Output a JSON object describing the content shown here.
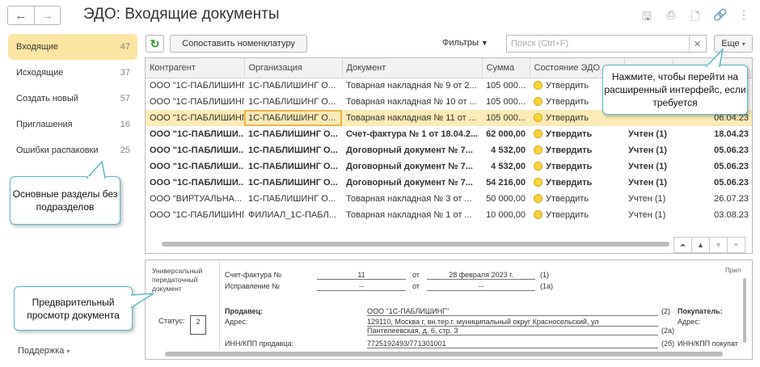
{
  "header": {
    "title": "ЭДО: Входящие документы",
    "back": "←",
    "forward": "→"
  },
  "top_icons": [
    "save-icon",
    "print-icon",
    "preview-icon",
    "link-icon",
    "more-vertical-icon"
  ],
  "sidebar": {
    "items": [
      {
        "label": "Входящие",
        "count": "47",
        "active": true
      },
      {
        "label": "Исходящие",
        "count": "37"
      },
      {
        "label": "Создать новый",
        "count": "57"
      },
      {
        "label": "Приглашения",
        "count": "16"
      },
      {
        "label": "Ошибки распаковки",
        "count": "25"
      }
    ],
    "support": "Поддержка"
  },
  "callouts": {
    "sections": "Основные разделы без подразделов",
    "preview": "Предварительный просмотр документа",
    "advanced": "Нажмите, чтобы перейти на расширенный интерфейс, если требуется"
  },
  "toolbar": {
    "match_label": "Сопоставить номенклатуру",
    "filters_label": "Фильтры",
    "search_placeholder": "Поиск (Ctrl+F)",
    "more_label": "Еще"
  },
  "table": {
    "columns": [
      "Контрагент",
      "Организация",
      "Документ",
      "Сумма",
      "Состояние ЭДО",
      "",
      ""
    ],
    "rows": [
      {
        "c": "ООО \"1С-ПАБЛИШИНГ\"",
        "o": "1С-ПАБЛИШИНГ О...",
        "d": "Товарная накладная № 9 от 2...",
        "s": "105 000...",
        "st": "Утвердить",
        "acc": "",
        "date": "",
        "bold": false
      },
      {
        "c": "ООО \"1С-ПАБЛИШИНГ\"",
        "o": "1С-ПАБЛИШИНГ О...",
        "d": "Товарная накладная № 10 от ...",
        "s": "105 000...",
        "st": "Утвердить",
        "acc": "",
        "date": "",
        "bold": false
      },
      {
        "c": "ООО \"1С-ПАБЛИШИНГ\"",
        "o": "1С-ПАБЛИШИНГ О...",
        "d": "Товарная накладная № 11 от ...",
        "s": "105 000...",
        "st": "Утвердить",
        "acc": "",
        "date": "06.04.23",
        "bold": false,
        "selected": true
      },
      {
        "c": "ООО \"1С-ПАБЛИШИ...",
        "o": "1С-ПАБЛИШИНГ О...",
        "d": "Счет-фактура № 1 от 18.04.2...",
        "s": "62 000,00",
        "st": "Утвердить",
        "acc": "Учтен (1)",
        "date": "18.04.23",
        "bold": true
      },
      {
        "c": "ООО \"1С-ПАБЛИШИ...",
        "o": "1С-ПАБЛИШИНГ О...",
        "d": "Договорный документ № 7...",
        "s": "4 532,00",
        "st": "Утвердить",
        "acc": "Учтен (1)",
        "date": "05.06.23",
        "bold": true
      },
      {
        "c": "ООО \"1С-ПАБЛИШИ...",
        "o": "1С-ПАБЛИШИНГ О...",
        "d": "Договорный документ № 7...",
        "s": "4 532,00",
        "st": "Утвердить",
        "acc": "Учтен (1)",
        "date": "05.06.23",
        "bold": true
      },
      {
        "c": "ООО \"1С-ПАБЛИШИ...",
        "o": "1С-ПАБЛИШИНГ О...",
        "d": "Договорный документ № 7...",
        "s": "54 216,00",
        "st": "Утвердить",
        "acc": "Учтен (1)",
        "date": "05.06.23",
        "bold": true
      },
      {
        "c": "ООО \"ВИРТУАЛЬНА...",
        "o": "1С-ПАБЛИШИНГ О...",
        "d": "Товарная накладная № 3 от ...",
        "s": "50 000,00",
        "st": "Утвердить",
        "acc": "Учтен (1)",
        "date": "26.07.23",
        "bold": false
      },
      {
        "c": "ООО \"1С-ПАБЛИШИНГ\"",
        "o": "ФИЛИАЛ_1С-ПАБЛ...",
        "d": "Товарная накладная № 1 от ...",
        "s": "10 000,00",
        "st": "Утвердить",
        "acc": "Учтен (1)",
        "date": "03.08.23",
        "bold": false
      }
    ]
  },
  "preview": {
    "doc_type": "Универсальный передаточный документ",
    "status_label": "Статус:",
    "status_value": "2",
    "appendix": "Прил",
    "invoice_label": "Счет-фактура №",
    "invoice_no": "11",
    "from": "от",
    "invoice_date": "28 февраля 2023 г.",
    "n1": "(1)",
    "correction_label": "Исправление №",
    "dash": "--",
    "n1a": "(1а)",
    "seller_label": "Продавец:",
    "seller": "ООО \"1С-ПАБЛИШИНГ\"",
    "n2": "(2)",
    "buyer_label": "Покупатель:",
    "address_label": "Адрес:",
    "address1": "129110, Москва г, вн.тер.г. муниципальный округ Красносельский, ул",
    "address2": "Пантелеевская, д. 6, стр. 3",
    "n2a": "(2а)",
    "buyer_address_label": "Адрес:",
    "inn_label": "ИНН/КПП продавца:",
    "inn": "7725192493/771301001",
    "n2b": "(2б)",
    "buyer_inn_label": "ИНН/КПП покупат"
  }
}
